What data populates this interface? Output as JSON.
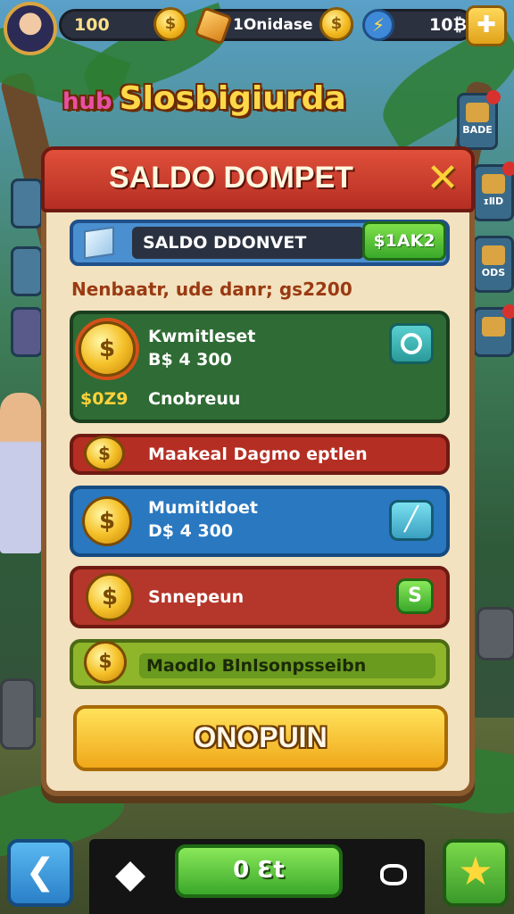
{
  "topbar": {
    "coins": "100",
    "gems": "1Onidase",
    "energy": "10₿",
    "gem_label_icon": "gem-icon"
  },
  "title": {
    "prefix": "hub",
    "main": "Slosbigiurda"
  },
  "side_tiles": [
    "BADE",
    "ɪⅡD",
    "ODS"
  ],
  "modal": {
    "title": "SALDO DOMPET",
    "close": "✕",
    "balance_label": "SALDO DDONVET",
    "balance_amount": "$1AK2",
    "subtitle": "Nenbaatr, ude danr; gs2200",
    "cards": [
      {
        "line1": "Kwmitleset",
        "line2": "B$ 4 300",
        "line3": "$0Z9",
        "line4": "Cnobreuu",
        "action_icon": "search-icon",
        "color": "#2f6b34"
      },
      {
        "line1": "Maakeal Dagmo eptlen",
        "color": "#b52e23"
      },
      {
        "line1": "Mumitldoet",
        "line2": "D$ 4 300",
        "action_icon": "edit-icon",
        "color": "#2a78c0"
      },
      {
        "line1": "Snnepeun",
        "action_label": "S",
        "color": "#b5362a"
      },
      {
        "line1": "Maodlo Blnlsonpsseibn",
        "color": "#8fb52a"
      }
    ],
    "main_button": "ONOPUIN"
  },
  "bottombar": {
    "back": "back-icon",
    "diamond": "diamond-icon",
    "center_label": "0 Ɛt",
    "right_icon": "swirl-icon",
    "star": "star-icon"
  }
}
